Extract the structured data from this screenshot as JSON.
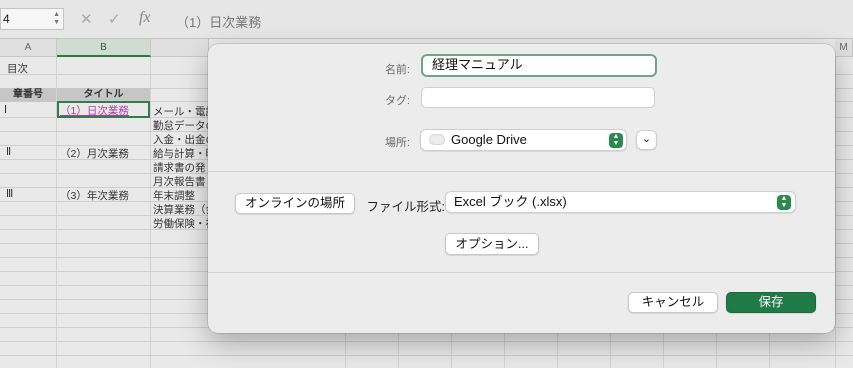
{
  "excel": {
    "name_box": "4",
    "formula_content": "（1）日次業務",
    "column_headers": [
      "A",
      "B",
      "M"
    ],
    "cells": {
      "a1": "目次",
      "header_a": "章番号",
      "header_b": "タイトル",
      "r1_a": "Ⅰ",
      "r1_b": "（1）日次業務",
      "r1_c": "メール・電話",
      "r2_c": "勤怠データの",
      "r3_c": "入金・出金の",
      "r4_a": "Ⅱ",
      "r4_b": "（2）月次業務",
      "r4_c": "給与計算・明",
      "r5_c": "請求書の発",
      "r6_c": "月次報告書",
      "r7_a": "Ⅲ",
      "r7_b": "（3）年次業務",
      "r7_c": "年末調整",
      "r8_c": "決算業務（会",
      "r9_c": "労働保険・社"
    },
    "link_color": "#b23ca8",
    "selection_color": "#2e7d4a"
  },
  "dialog": {
    "name_label": "名前:",
    "name_value": "経理マニュアル",
    "tags_label": "タグ:",
    "tags_value": "",
    "location_label": "場所:",
    "location_value": "Google Drive",
    "online_locations_button": "オンラインの場所",
    "format_label": "ファイル形式:",
    "format_value": "Excel ブック (.xlsx)",
    "options_button": "オプション...",
    "cancel_button": "キャンセル",
    "save_button": "保存",
    "accent_color": "#1f7a45"
  }
}
